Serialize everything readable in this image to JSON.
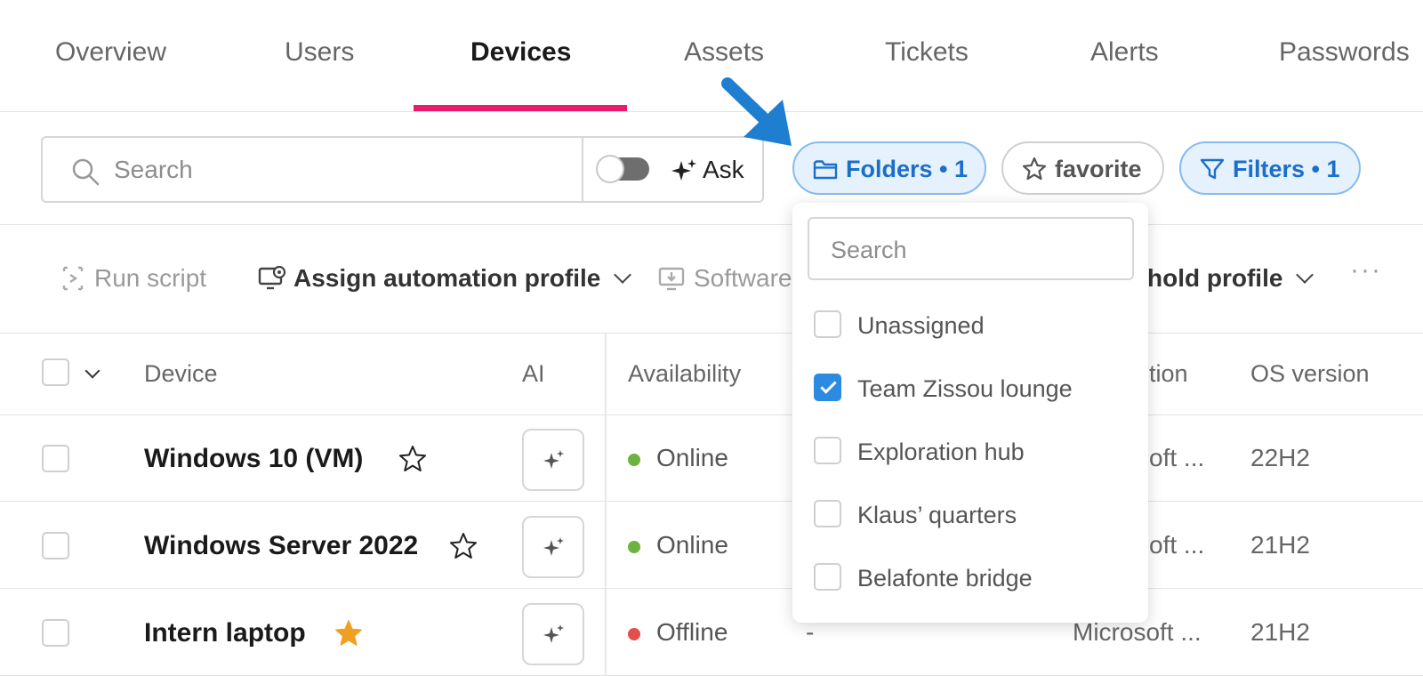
{
  "tabs": [
    {
      "label": "Overview"
    },
    {
      "label": "Users"
    },
    {
      "label": "Devices",
      "active": true
    },
    {
      "label": "Assets"
    },
    {
      "label": "Tickets"
    },
    {
      "label": "Alerts"
    },
    {
      "label": "Passwords"
    }
  ],
  "colors": {
    "accent_tab": "#ec1a6c",
    "chip_blue": "#1b6fc9",
    "online": "#6cb33f",
    "offline": "#e2504c",
    "favorite_star": "#f0a020",
    "checked": "#2a8be0",
    "arrow": "#1e7fd0"
  },
  "search": {
    "placeholder": "Search",
    "icon": "search-icon"
  },
  "ask": {
    "label": "Ask",
    "icon": "sparkle-icon",
    "toggle_on": false
  },
  "chips": {
    "folders": {
      "label": "Folders • 1",
      "icon": "folder-icon"
    },
    "favorite": {
      "label": "favorite",
      "icon": "star-icon"
    },
    "filters": {
      "label": "Filters • 1",
      "icon": "filter-icon"
    }
  },
  "actions": {
    "run_script": {
      "label": "Run script",
      "icon": "script-icon",
      "enabled": false
    },
    "assign_profile": {
      "label": "Assign automation profile",
      "icon": "monitor-gear-icon"
    },
    "software": {
      "label": "Software",
      "icon": "download-monitor-icon",
      "enabled": false
    },
    "hold_profile": {
      "label": "hold profile"
    },
    "more": {
      "label": "···"
    }
  },
  "table": {
    "headers": {
      "device": "Device",
      "ai": "AI",
      "availability": "Availability",
      "location": "tion",
      "os_version": "OS version"
    },
    "rows": [
      {
        "device": "Windows 10 (VM)",
        "favorite": false,
        "availability": "Online",
        "col4": "",
        "os_family": "oft ...",
        "os_version": "22H2"
      },
      {
        "device": "Windows Server 2022",
        "favorite": false,
        "availability": "Online",
        "col4": "",
        "os_family": "oft ...",
        "os_version": "21H2"
      },
      {
        "device": "Intern laptop",
        "favorite": true,
        "availability": "Offline",
        "col4": "-",
        "os_family": "Microsoft ...",
        "os_version": "21H2"
      }
    ]
  },
  "folders_dropdown": {
    "search_placeholder": "Search",
    "items": [
      {
        "label": "Unassigned",
        "checked": false
      },
      {
        "label": "Team Zissou lounge",
        "checked": true
      },
      {
        "label": "Exploration hub",
        "checked": false
      },
      {
        "label": "Klaus’ quarters",
        "checked": false
      },
      {
        "label": "Belafonte bridge",
        "checked": false
      }
    ]
  }
}
